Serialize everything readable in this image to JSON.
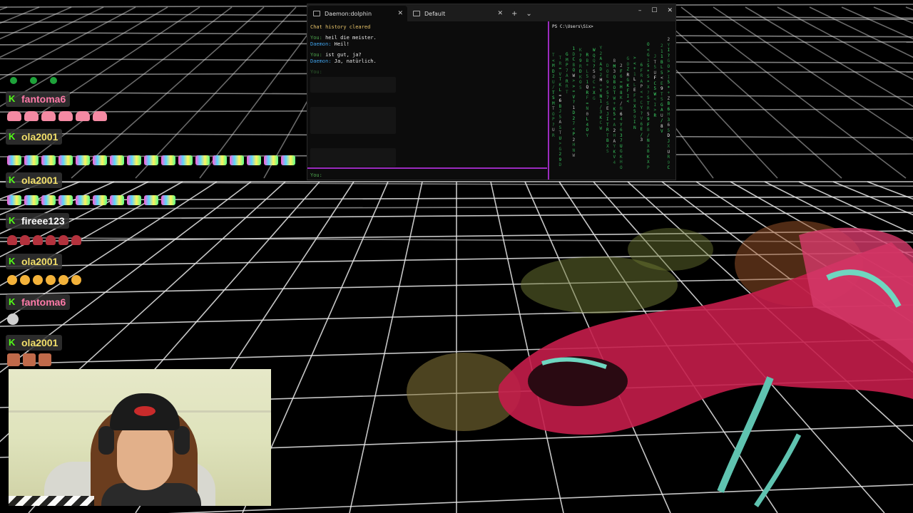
{
  "terminal": {
    "tabs": [
      {
        "label": "Daemon:dolphin",
        "active": true
      },
      {
        "label": "Default",
        "active": false
      }
    ],
    "close_symbol": "✕",
    "add_tab_symbol": "+",
    "dropdown_symbol": "⌄",
    "window_controls": {
      "minimize": "–",
      "maximize": "☐",
      "close": "✕"
    },
    "left_pane": {
      "status": "Chat history cleared",
      "lines": [
        {
          "speaker": "You:",
          "text": " heil die meister."
        },
        {
          "speaker": "Daemon:",
          "text": " Heil!"
        },
        {
          "speaker": "You:",
          "text": " ist gut, ja?"
        },
        {
          "speaker": "Daemon:",
          "text": " Ja, natürlich."
        }
      ],
      "prompt_label": "You:",
      "bottom_prompt": "You:"
    },
    "right_pane": {
      "prompt": "PS C:\\Users\\Six>"
    }
  },
  "chat": {
    "messages": [
      {
        "user": "",
        "emotes": [
          "green",
          "green",
          "green"
        ],
        "color": "none"
      },
      {
        "user": "fantoma6",
        "emotes": [
          "pink",
          "pink",
          "pink",
          "pink",
          "pink",
          "pink"
        ],
        "color": "pink"
      },
      {
        "user": "ola2001",
        "emotes": [
          "rainbow",
          "rainbow",
          "rainbow",
          "rainbow",
          "rainbow",
          "rainbow",
          "rainbow",
          "rainbow",
          "rainbow",
          "rainbow",
          "rainbow",
          "rainbow",
          "rainbow",
          "rainbow",
          "rainbow",
          "rainbow",
          "rainbow"
        ],
        "color": "yellow"
      },
      {
        "user": "ola2001",
        "emotes": [
          "rainbow",
          "rainbow",
          "rainbow",
          "rainbow",
          "rainbow",
          "rainbow",
          "rainbow",
          "rainbow",
          "rainbow",
          "rainbow"
        ],
        "color": "yellow"
      },
      {
        "user": "fireee123",
        "emotes": [
          "red",
          "red",
          "red",
          "red",
          "red",
          "red"
        ],
        "color": "white"
      },
      {
        "user": "ola2001",
        "emotes": [
          "laugh",
          "laugh",
          "laugh",
          "laugh",
          "laugh",
          "laugh"
        ],
        "color": "yellow"
      },
      {
        "user": "fantoma6",
        "emotes": [
          "round"
        ],
        "color": "pink"
      },
      {
        "user": "ola2001",
        "emotes": [
          "face",
          "face",
          "face"
        ],
        "color": "yellow"
      }
    ],
    "badge": "K"
  },
  "colors": {
    "accent_purple": "#9b2bbf",
    "kick_green": "#53fc18",
    "terminal_bg": "#0c0c0c"
  }
}
